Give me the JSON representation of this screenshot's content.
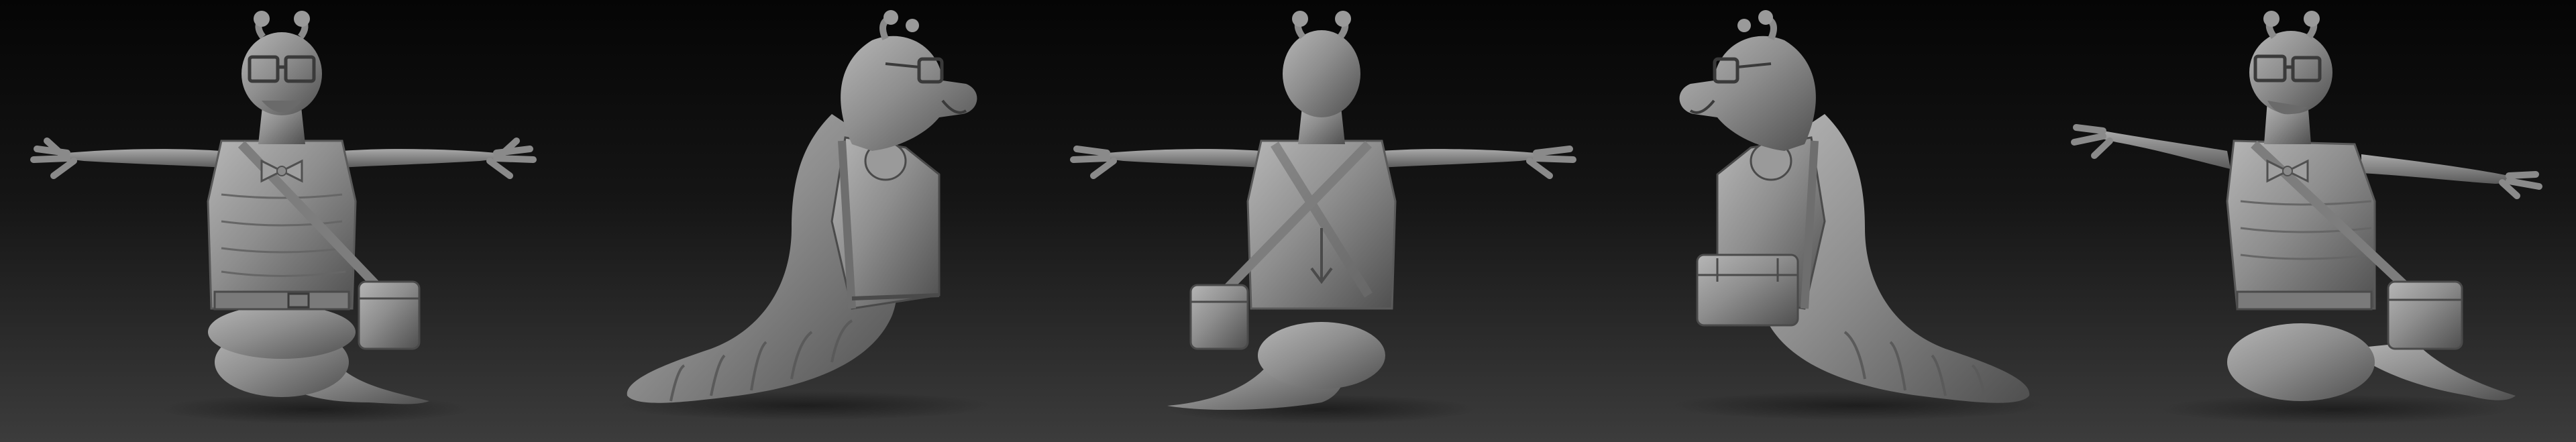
{
  "scene": {
    "subject": "grub-character-sculpt-turnaround",
    "background_color": "#2a2a2a",
    "material_color": "#8c8c8c",
    "views": [
      {
        "view": "front",
        "label": ""
      },
      {
        "view": "side-right",
        "label": ""
      },
      {
        "view": "back",
        "label": ""
      },
      {
        "view": "side-left",
        "label": ""
      },
      {
        "view": "three-quarter",
        "label": ""
      }
    ]
  }
}
